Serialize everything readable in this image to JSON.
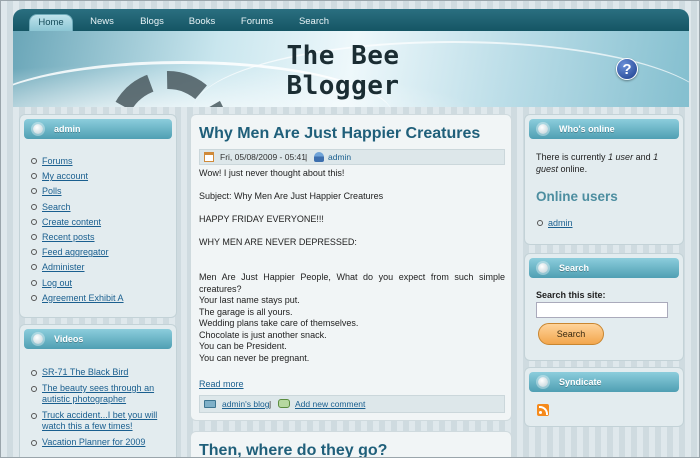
{
  "nav": {
    "tabs": [
      "Home",
      "News",
      "Blogs",
      "Books",
      "Forums",
      "Search"
    ],
    "active": "Home"
  },
  "header": {
    "site_title": "The Bee Blogger",
    "help_glyph": "?"
  },
  "sidebar_left": {
    "admin_block": {
      "title": "admin",
      "links": [
        "Forums",
        "My account",
        "Polls",
        "Search",
        "Create content",
        "Recent posts",
        "Feed aggregator",
        "Administer",
        "Log out",
        "Agreement Exhibit A"
      ]
    },
    "videos_block": {
      "title": "Videos",
      "links": [
        "SR-71 The Black Bird",
        "The beauty sees through an autistic photographer",
        "Truck accident...I bet you will watch this a few times!",
        "Vacation Planner for 2009"
      ]
    }
  },
  "main": {
    "post1": {
      "title": "Why Men Are Just Happier Creatures",
      "date": "Fri, 05/08/2009 - 05:41",
      "separator": "|",
      "author": "admin",
      "paragraphs": [
        "Wow! I just never thought about this!",
        "Subject: Why Men Are Just Happier Creatures",
        "HAPPY FRIDAY EVERYONE!!!",
        "WHY MEN ARE NEVER DEPRESSED:"
      ],
      "lines": [
        "Men Are Just Happier People, What do you expect from such simple creatures?",
        "Your last name stays put.",
        "The garage is all yours.",
        "Wedding plans take care of themselves.",
        "Chocolate is just another snack.",
        "You can be President.",
        "You can never be pregnant."
      ],
      "read_more": "Read more",
      "blog_link": "admin's blog",
      "comment_link": "Add new comment"
    },
    "post2": {
      "title": "Then, where do they go?"
    }
  },
  "sidebar_right": {
    "online": {
      "title": "Who's online",
      "status_prefix": "There is currently",
      "users_count": "1 user",
      "and": "and",
      "guests_count": "1 guest",
      "online_suffix": "online.",
      "online_users_heading": "Online users",
      "users": [
        "admin"
      ]
    },
    "search": {
      "title": "Search",
      "label": "Search this site:",
      "value": "",
      "button": "Search"
    },
    "syndicate": {
      "title": "Syndicate"
    }
  },
  "colors": {
    "accent": "#4f9fb3",
    "title": "#1f5f7a",
    "link": "#1a5f8f",
    "button": "#f2a64d"
  }
}
